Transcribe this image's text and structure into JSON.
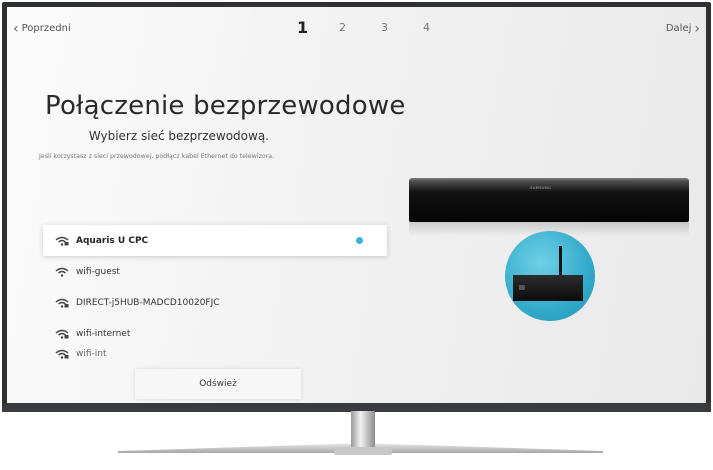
{
  "nav": {
    "prev_label": "Poprzedni",
    "next_label": "Dalej",
    "steps": [
      "1",
      "2",
      "3",
      "4"
    ],
    "active_step": "1"
  },
  "title": "Połączenie bezprzewodowe",
  "subtitle": "Wybierz sieć bezprzewodową.",
  "hint": "Jeśli korzystasz z sieci przewodowej, podłącz kabel Ethernet do telewizora.",
  "networks": [
    {
      "name": "Aquaris U CPC",
      "secured": true,
      "selected": true
    },
    {
      "name": "wifi-guest",
      "secured": false,
      "selected": false
    },
    {
      "name": "DIRECT-j5HUB-MADCD10020FJC",
      "secured": true,
      "selected": false
    },
    {
      "name": "wifi-internet",
      "secured": true,
      "selected": false
    },
    {
      "name": "wifi-int",
      "secured": true,
      "selected": false
    }
  ],
  "refresh_label": "Odśwież",
  "device": {
    "logo": "SAMSUNG"
  },
  "colors": {
    "accent": "#3ab4d6",
    "bezel": "#2f3033"
  },
  "icons": {
    "secured": "wifi-lock-icon",
    "open": "wifi-icon"
  }
}
